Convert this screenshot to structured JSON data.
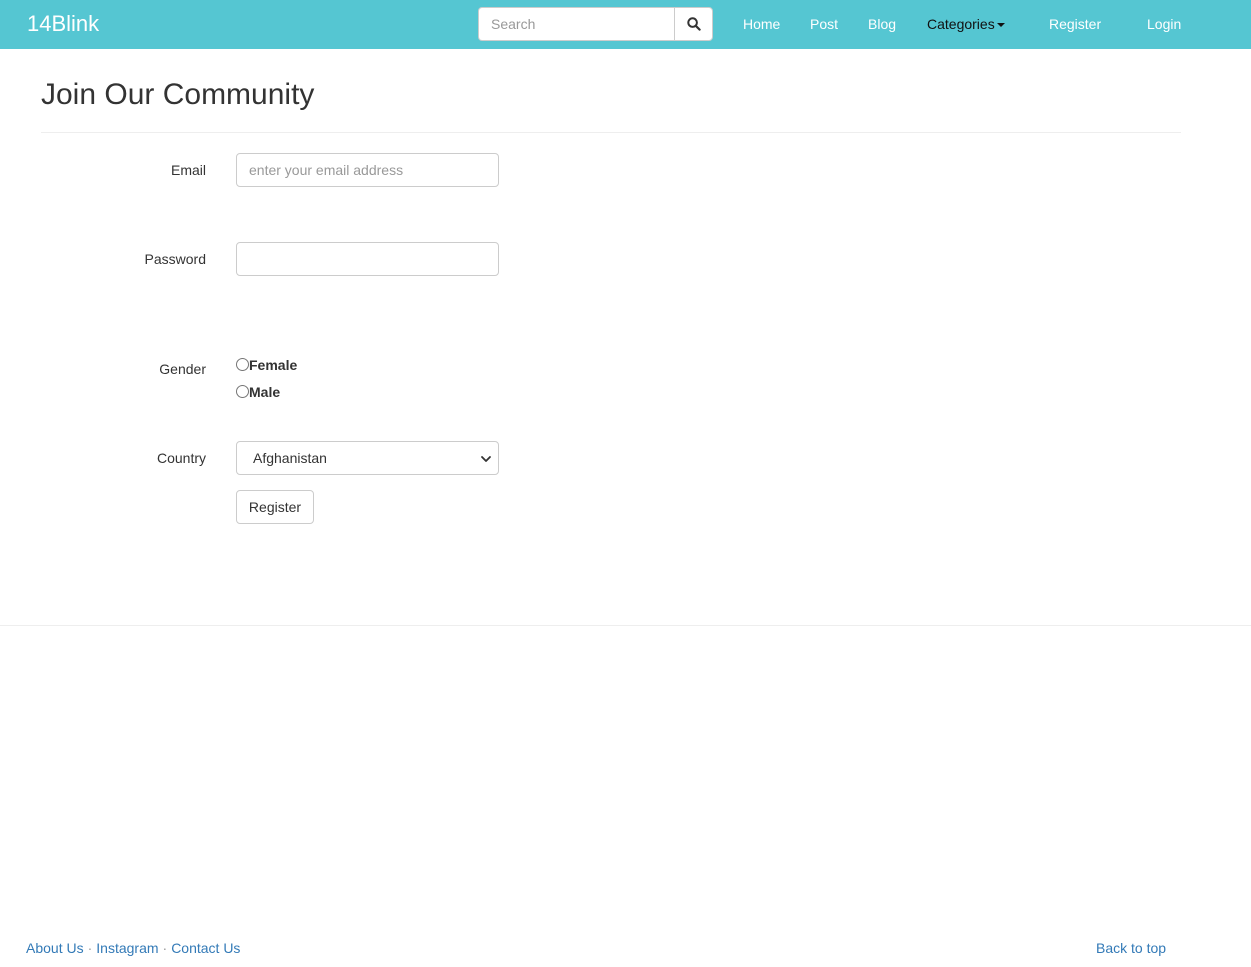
{
  "navbar": {
    "brand": "14Blink",
    "search_placeholder": "Search",
    "links": {
      "home": "Home",
      "post": "Post",
      "blog": "Blog",
      "categories": "Categories",
      "register": "Register",
      "login": "Login"
    },
    "bg_color": "#55c6d2"
  },
  "page": {
    "title": "Join Our Community"
  },
  "form": {
    "email_label": "Email",
    "email_placeholder": "enter your email address",
    "email_value": "",
    "password_label": "Password",
    "password_value": "",
    "gender_label": "Gender",
    "gender_options": [
      "Female",
      "Male"
    ],
    "gender_selected": null,
    "country_label": "Country",
    "country_selected": "Afghanistan",
    "submit_label": "Register"
  },
  "footer": {
    "links": [
      "About Us",
      "Instagram",
      "Contact Us"
    ],
    "separator": "·",
    "back_to_top": "Back to top"
  },
  "icons": {
    "search": "search-icon",
    "caret": "caret-down-icon",
    "select_chevron": "chevron-down-icon"
  }
}
